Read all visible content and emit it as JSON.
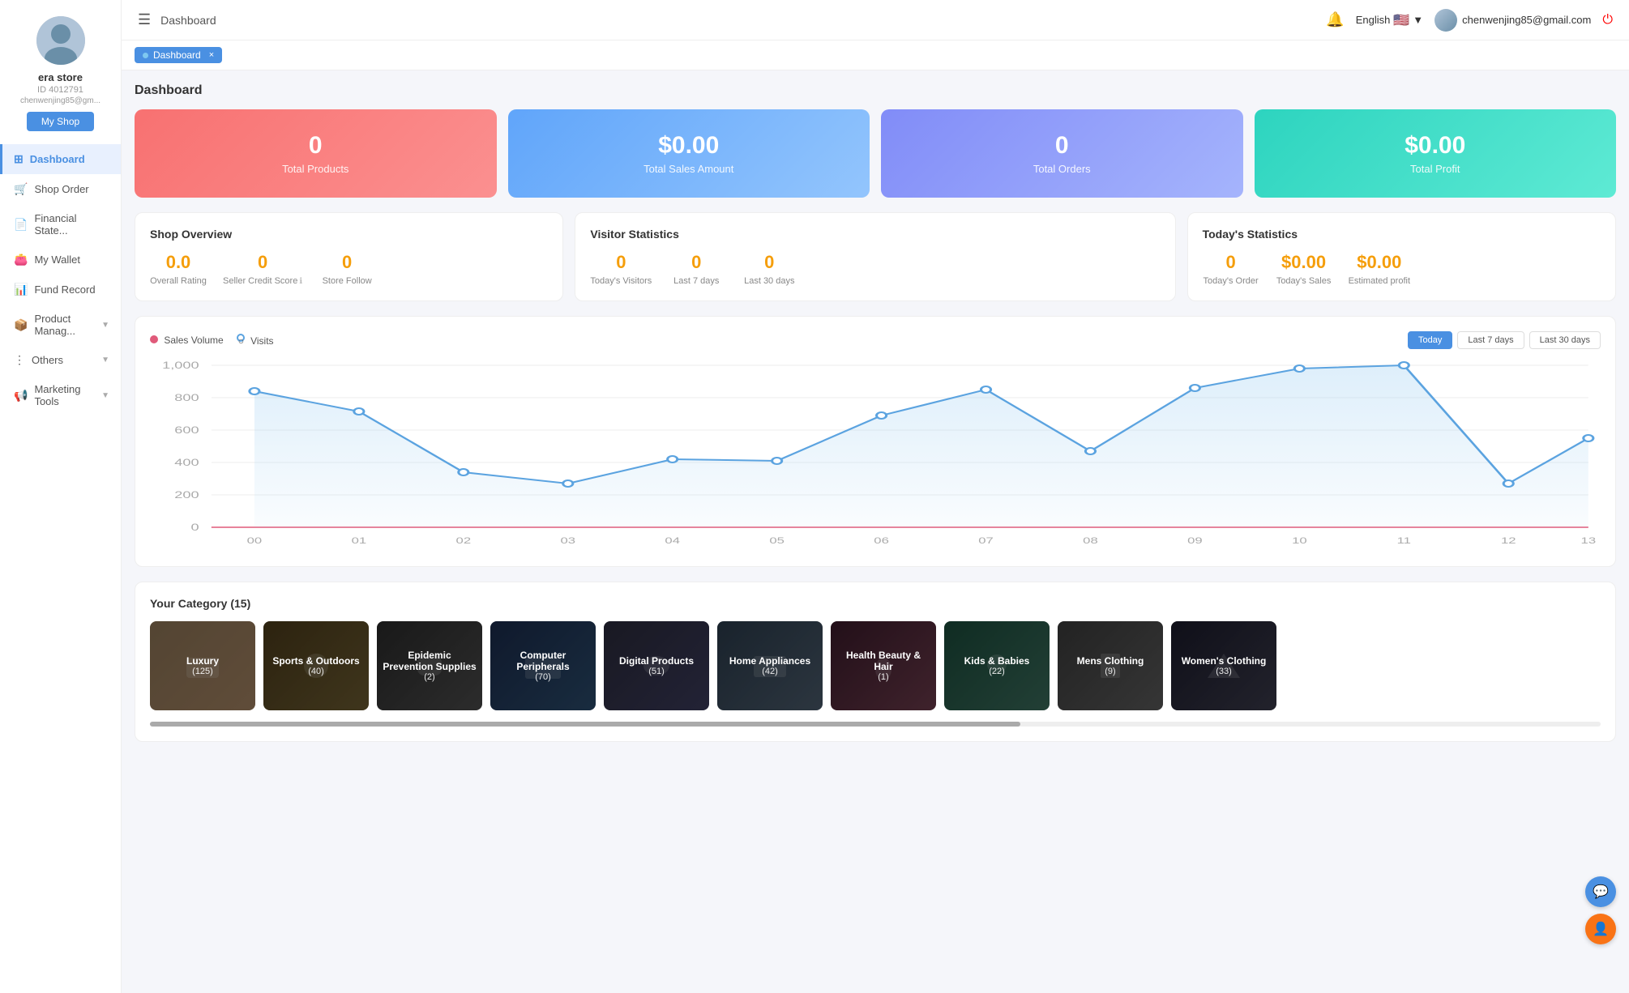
{
  "sidebar": {
    "avatar_alt": "user avatar",
    "store_name": "era store",
    "store_id": "ID 4012791",
    "email": "chenwenjing85@gm...",
    "myshop_btn": "My Shop",
    "nav_items": [
      {
        "id": "dashboard",
        "label": "Dashboard",
        "icon": "⊞",
        "active": true,
        "has_chevron": false
      },
      {
        "id": "shop-order",
        "label": "Shop Order",
        "icon": "🛒",
        "active": false,
        "has_chevron": false
      },
      {
        "id": "financial-state",
        "label": "Financial State...",
        "icon": "📄",
        "active": false,
        "has_chevron": false
      },
      {
        "id": "my-wallet",
        "label": "My Wallet",
        "icon": "👛",
        "active": false,
        "has_chevron": false
      },
      {
        "id": "fund-record",
        "label": "Fund Record",
        "icon": "📊",
        "active": false,
        "has_chevron": false
      },
      {
        "id": "product-manage",
        "label": "Product Manag...",
        "icon": "📦",
        "active": false,
        "has_chevron": true
      },
      {
        "id": "others",
        "label": "Others",
        "icon": "⋮",
        "active": false,
        "has_chevron": true
      },
      {
        "id": "marketing-tools",
        "label": "Marketing Tools",
        "icon": "📢",
        "active": false,
        "has_chevron": true
      }
    ]
  },
  "header": {
    "menu_icon": "☰",
    "title": "Dashboard",
    "language": "English",
    "email": "chenwenjing85@gmail.com"
  },
  "breadcrumb": {
    "label": "Dashboard",
    "close": "×"
  },
  "dashboard": {
    "title": "Dashboard",
    "stat_cards": [
      {
        "id": "total-products",
        "value": "0",
        "label": "Total Products",
        "color_class": "card-pink"
      },
      {
        "id": "total-sales",
        "value": "$0.00",
        "label": "Total Sales Amount",
        "color_class": "card-blue"
      },
      {
        "id": "total-orders",
        "value": "0",
        "label": "Total Orders",
        "color_class": "card-purple"
      },
      {
        "id": "total-profit",
        "value": "$0.00",
        "label": "Total Profit",
        "color_class": "card-teal"
      }
    ],
    "shop_overview": {
      "title": "Shop Overview",
      "metrics": [
        {
          "id": "overall-rating",
          "value": "0.0",
          "label": "Overall Rating",
          "has_info": false
        },
        {
          "id": "seller-credit",
          "value": "0",
          "label": "Seller Credit Score",
          "has_info": true
        },
        {
          "id": "store-follow",
          "value": "0",
          "label": "Store Follow",
          "has_info": false
        }
      ]
    },
    "visitor_stats": {
      "title": "Visitor Statistics",
      "metrics": [
        {
          "id": "todays-visitors",
          "value": "0",
          "label": "Today's Visitors"
        },
        {
          "id": "last-7-days",
          "value": "0",
          "label": "Last 7 days"
        },
        {
          "id": "last-30-days",
          "value": "0",
          "label": "Last 30 days"
        }
      ]
    },
    "todays_stats": {
      "title": "Today's Statistics",
      "metrics": [
        {
          "id": "todays-order",
          "value": "0",
          "label": "Today's Order",
          "is_currency": false
        },
        {
          "id": "todays-sales",
          "value": "$0.00",
          "label": "Today's Sales",
          "is_currency": true
        },
        {
          "id": "estimated-profit",
          "value": "$0.00",
          "label": "Estimated profit",
          "is_currency": true
        }
      ]
    },
    "chart": {
      "legend_sales": "Sales Volume",
      "legend_visits": "Visits",
      "btn_today": "Today",
      "btn_7days": "Last 7 days",
      "btn_30days": "Last 30 days",
      "x_labels": [
        "00",
        "01",
        "02",
        "03",
        "04",
        "05",
        "06",
        "07",
        "08",
        "09",
        "10",
        "11",
        "12",
        "13"
      ],
      "y_labels": [
        "0",
        "200",
        "400",
        "600",
        "800",
        "1,000"
      ],
      "visits_data": [
        850,
        730,
        380,
        310,
        470,
        460,
        650,
        810,
        520,
        870,
        1000,
        1050,
        270,
        640
      ]
    },
    "category": {
      "title": "Your Category",
      "count": 15,
      "items": [
        {
          "id": "luxury",
          "name": "Luxury",
          "count": "(125)",
          "color": "#8B7355"
        },
        {
          "id": "sports-outdoors",
          "name": "Sports & Outdoors",
          "count": "(40)",
          "color": "#5c4a2a"
        },
        {
          "id": "epidemic-prevention",
          "name": "Epidemic Prevention Supplies",
          "count": "(2)",
          "color": "#3a3a3a"
        },
        {
          "id": "computer-peripherals",
          "name": "Computer Peripherals",
          "count": "(70)",
          "color": "#1a2a4a"
        },
        {
          "id": "digital-products",
          "name": "Digital Products",
          "count": "(51)",
          "color": "#2a2a2a"
        },
        {
          "id": "home-appliances",
          "name": "Home Appliances",
          "count": "(42)",
          "color": "#3a3a4a"
        },
        {
          "id": "health-beauty",
          "name": "Health Beauty & Hair",
          "count": "(1)",
          "color": "#4a2a2a"
        },
        {
          "id": "kids-babies",
          "name": "Kids & Babies",
          "count": "(22)",
          "color": "#2a4a3a"
        },
        {
          "id": "mens-clothing",
          "name": "Mens Clothing",
          "count": "(9)",
          "color": "#4a4a4a"
        },
        {
          "id": "womens-clothing",
          "name": "Women's Clothing",
          "count": "(33)",
          "color": "#2a2a2a"
        }
      ]
    }
  }
}
